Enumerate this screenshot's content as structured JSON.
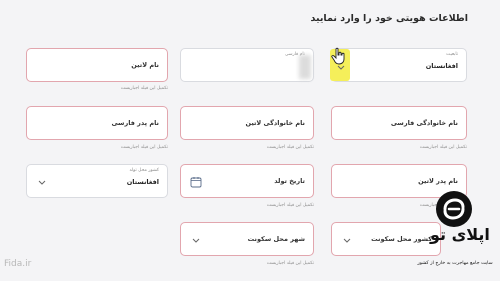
{
  "page": {
    "title": "اطلاعات هویتی خود را وارد نمایید"
  },
  "helper_text": "تکمیل این فیلد اجباریست",
  "fields": {
    "nationality": {
      "label": "تابعیت",
      "value": "افغانستان"
    },
    "persian_name": {
      "label": "نام فارسی"
    },
    "latin_name": {
      "label": "نام لاتین"
    },
    "persian_family": {
      "label": "نام خانوادگی فارسی"
    },
    "latin_family": {
      "label": "نام خانوادگی لاتین"
    },
    "father_persian": {
      "label": "نام پدر فارسی"
    },
    "father_latin": {
      "label": "نام پدر لاتین"
    },
    "birth_date": {
      "label": "تاریخ تولد"
    },
    "birth_country": {
      "label": "کشور محل تولد",
      "value": "افغانستان"
    },
    "residence_country": {
      "label": "کشور محل سکونت"
    },
    "residence_city": {
      "label": "شهر محل سکونت"
    }
  },
  "icons": {
    "chevron": "chevron-down-icon",
    "calendar": "calendar-icon",
    "cursor": "hand-pointer-icon"
  },
  "watermarks": {
    "fida": "Fida.ir",
    "logo_text": "اپلای تو",
    "logo_sub": "سایت جامع مهاجرت به خارج از کشور"
  },
  "colors": {
    "required_border": "#e2a6ae",
    "highlight": "#f5ef5a",
    "background": "#f4f4f6"
  }
}
